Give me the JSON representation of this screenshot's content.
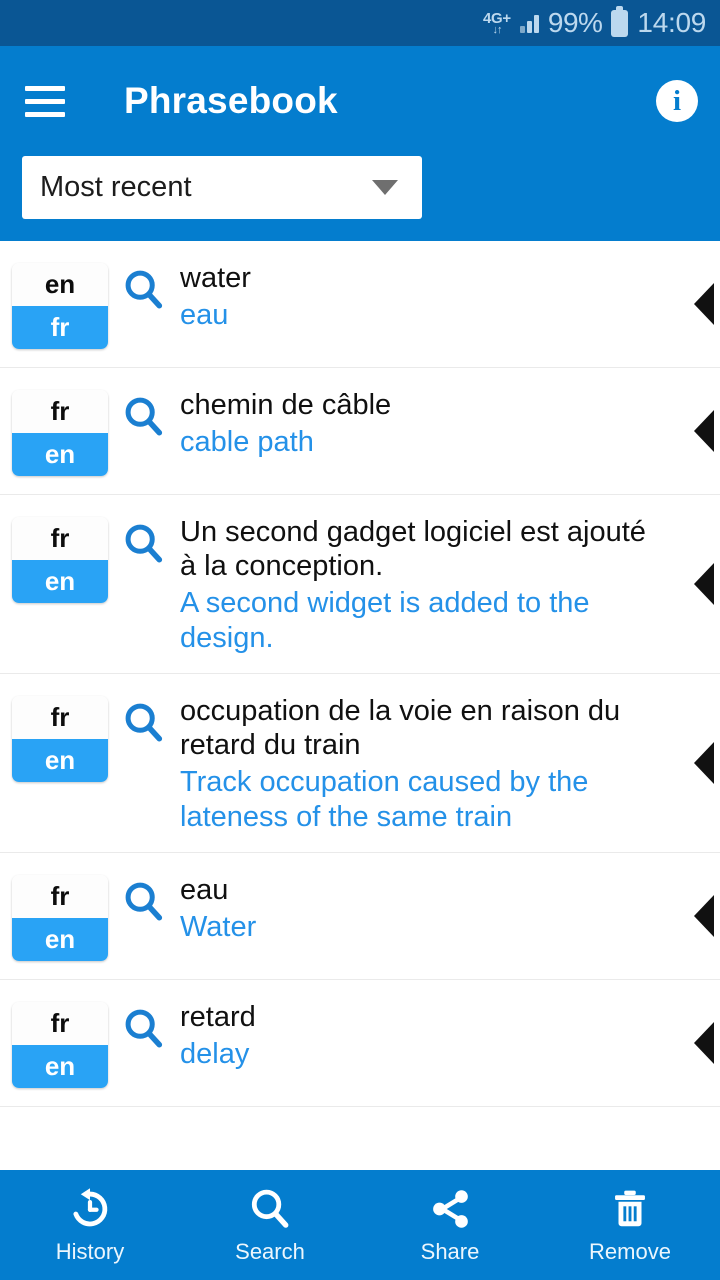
{
  "status_bar": {
    "network_label": "4G+",
    "network_arrows": "↓↑",
    "battery_percent": "99%",
    "time": "14:09",
    "signal_icon": "signal-bars-icon",
    "battery_icon": "battery-icon"
  },
  "app_bar": {
    "title": "Phrasebook",
    "menu_icon": "hamburger-menu-icon",
    "info_icon": "info-icon",
    "info_glyph": "i"
  },
  "sort": {
    "selected": "Most recent",
    "chevron_icon": "chevron-down-icon"
  },
  "entries": [
    {
      "source_lang": "en",
      "target_lang": "fr",
      "source_text": "water",
      "target_text": "eau",
      "search_icon": "search-icon",
      "expand_icon": "triangle-left-icon"
    },
    {
      "source_lang": "fr",
      "target_lang": "en",
      "source_text": "chemin de câble",
      "target_text": "cable path",
      "search_icon": "search-icon",
      "expand_icon": "triangle-left-icon"
    },
    {
      "source_lang": "fr",
      "target_lang": "en",
      "source_text": "Un second gadget logiciel est ajouté à la conception.",
      "target_text": "A second widget is added to the design.",
      "search_icon": "search-icon",
      "expand_icon": "triangle-left-icon"
    },
    {
      "source_lang": "fr",
      "target_lang": "en",
      "source_text": "occupation de la voie en raison du retard du train",
      "target_text": "Track occupation caused by the lateness of the same train",
      "search_icon": "search-icon",
      "expand_icon": "triangle-left-icon"
    },
    {
      "source_lang": "fr",
      "target_lang": "en",
      "source_text": "eau",
      "target_text": "Water",
      "search_icon": "search-icon",
      "expand_icon": "triangle-left-icon"
    },
    {
      "source_lang": "fr",
      "target_lang": "en",
      "source_text": "retard",
      "target_text": "delay",
      "search_icon": "search-icon",
      "expand_icon": "triangle-left-icon"
    }
  ],
  "bottom_nav": [
    {
      "label": "History",
      "icon": "history-icon"
    },
    {
      "label": "Search",
      "icon": "search-icon"
    },
    {
      "label": "Share",
      "icon": "share-icon"
    },
    {
      "label": "Remove",
      "icon": "trash-icon"
    }
  ],
  "colors": {
    "status_bar": "#0a5694",
    "app_bar": "#047dce",
    "accent_blue": "#29a3f5",
    "translation_text": "#2491e8",
    "source_text": "#101010"
  }
}
